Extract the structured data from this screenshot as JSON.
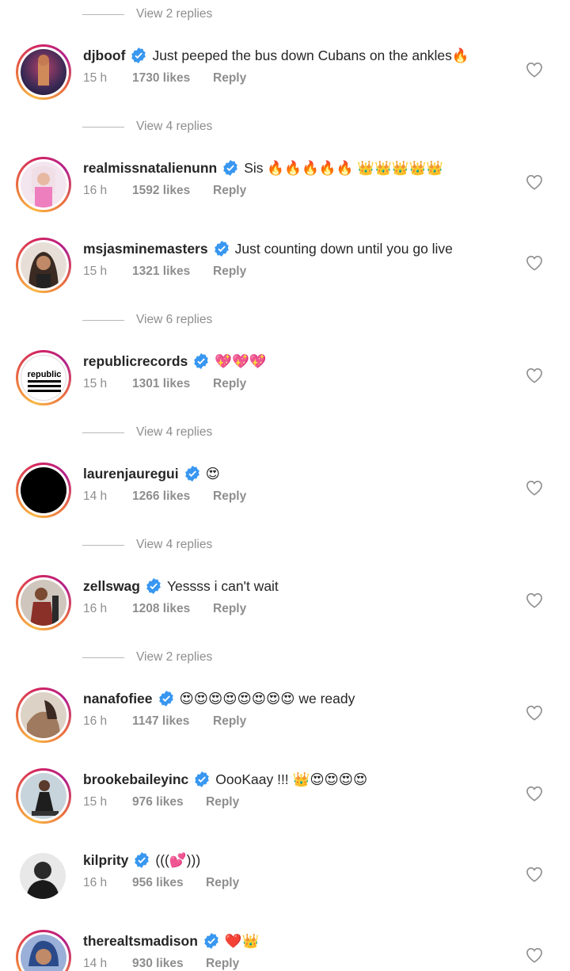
{
  "view_replies": [
    "View 2 replies",
    "View 4 replies",
    "View 6 replies",
    "View 4 replies",
    "View 4 replies",
    "View 2 replies"
  ],
  "comments": [
    {
      "username": "djboof",
      "text": "Just peeped the bus down Cubans on the ankles🔥",
      "time": "15 h",
      "likes": "1730 likes",
      "reply": "Reply",
      "avatar_color": "#3a2a55"
    },
    {
      "username": "realmissnatalienunn",
      "text": "Sis 🔥🔥🔥🔥🔥 👑👑👑👑👑",
      "time": "16 h",
      "likes": "1592 likes",
      "reply": "Reply",
      "avatar_color": "#f2a7cf"
    },
    {
      "username": "msjasminemasters",
      "text": "Just counting down until you go live",
      "time": "15 h",
      "likes": "1321 likes",
      "reply": "Reply",
      "avatar_color": "#5a4030"
    },
    {
      "username": "republicrecords",
      "text": "💖💖💖",
      "time": "15 h",
      "likes": "1301 likes",
      "reply": "Reply",
      "avatar_color": "#ffffff",
      "logo_text": "republic",
      "logo_sub": "records"
    },
    {
      "username": "laurenjauregui",
      "text": "😍",
      "time": "14 h",
      "likes": "1266 likes",
      "reply": "Reply",
      "avatar_color": "#000000"
    },
    {
      "username": "zellswag",
      "text": "Yessss i can't wait",
      "time": "16 h",
      "likes": "1208 likes",
      "reply": "Reply",
      "avatar_color": "#7a3a30"
    },
    {
      "username": "nanafofiee",
      "text": "😍😍😍😍😍😍😍😍 we ready",
      "time": "16 h",
      "likes": "1147 likes",
      "reply": "Reply",
      "avatar_color": "#c9a488"
    },
    {
      "username": "brookebaileyinc",
      "text": "OooKaay !!! 👑😍😍😍😍",
      "time": "15 h",
      "likes": "976 likes",
      "reply": "Reply",
      "avatar_color": "#8a9aa8"
    },
    {
      "username": "kilprity",
      "text": "(((💕)))",
      "time": "16 h",
      "likes": "956 likes",
      "reply": "Reply",
      "avatar_color": "#2a2a2a"
    },
    {
      "username": "therealtsmadison",
      "text": "❤️👑",
      "time": "14 h",
      "likes": "930 likes",
      "reply": "Reply",
      "avatar_color": "#4a6aa0"
    }
  ],
  "colors": {
    "verified": "#3897f0",
    "muted": "#8e8e8e",
    "text": "#262626"
  }
}
